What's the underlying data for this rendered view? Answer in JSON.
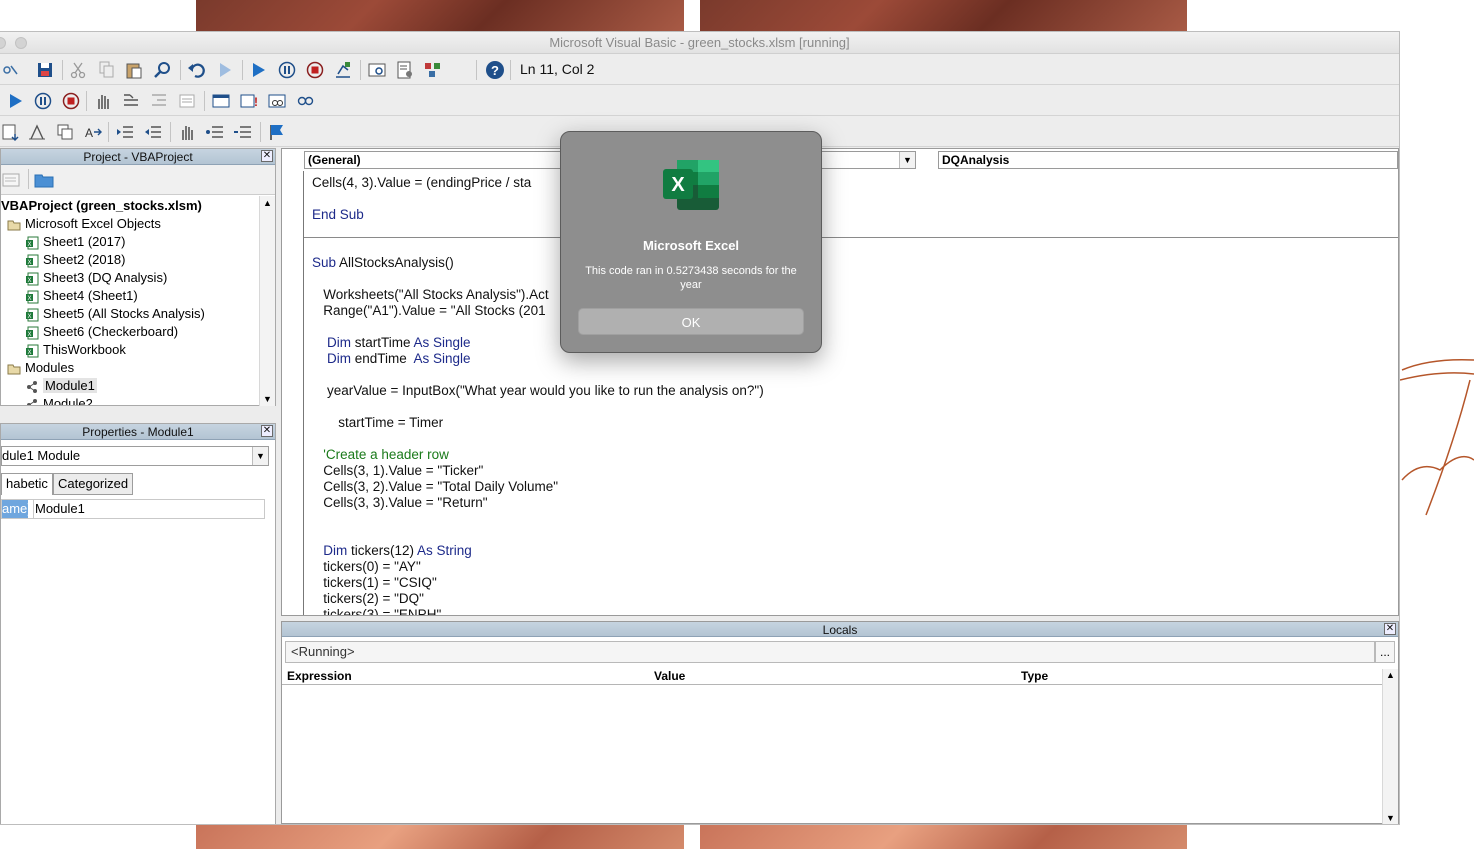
{
  "window": {
    "title": "Microsoft Visual Basic - green_stocks.xlsm [running]"
  },
  "toolbar": {
    "cursor_position": "Ln 11, Col 2"
  },
  "project_panel": {
    "title": "Project - VBAProject",
    "items": [
      {
        "label": "VBAProject (green_stocks.xlsm)",
        "level": 0,
        "type": "project"
      },
      {
        "label": "Microsoft Excel Objects",
        "level": 1,
        "type": "folder"
      },
      {
        "label": "Sheet1 (2017)",
        "level": 2,
        "type": "sheet"
      },
      {
        "label": "Sheet2 (2018)",
        "level": 2,
        "type": "sheet"
      },
      {
        "label": "Sheet3 (DQ Analysis)",
        "level": 2,
        "type": "sheet"
      },
      {
        "label": "Sheet4 (Sheet1)",
        "level": 2,
        "type": "sheet"
      },
      {
        "label": "Sheet5 (All Stocks Analysis)",
        "level": 2,
        "type": "sheet"
      },
      {
        "label": "Sheet6 (Checkerboard)",
        "level": 2,
        "type": "sheet"
      },
      {
        "label": "ThisWorkbook",
        "level": 2,
        "type": "sheet"
      },
      {
        "label": "Modules",
        "level": 1,
        "type": "folder"
      },
      {
        "label": "Module1",
        "level": 2,
        "type": "module"
      },
      {
        "label": "Module2",
        "level": 2,
        "type": "module"
      }
    ]
  },
  "properties_panel": {
    "title": "Properties - Module1",
    "object_combo": "dule1  Module",
    "tabs": [
      "habetic",
      "Categorized"
    ],
    "row_name": "ame)",
    "row_value": "Module1"
  },
  "code_window": {
    "object_combo": "(General)",
    "procedure_combo": "DQAnalysis",
    "lines": [
      {
        "segments": [
          {
            "t": "Cells(4, 3).Value = (endingPrice / sta",
            "c": "n"
          }
        ]
      },
      {
        "segments": [
          {
            "t": "",
            "c": "n"
          }
        ]
      },
      {
        "segments": [
          {
            "t": "End Sub",
            "c": "k"
          }
        ]
      },
      {
        "segments": [
          {
            "t": "",
            "c": "n"
          }
        ]
      },
      {
        "segments": [
          {
            "t": "Sub ",
            "c": "k"
          },
          {
            "t": "AllStocksAnalysis()",
            "c": "n"
          }
        ]
      },
      {
        "segments": [
          {
            "t": "",
            "c": "n"
          }
        ]
      },
      {
        "segments": [
          {
            "t": "   Worksheets(\"All Stocks Analysis\").Act",
            "c": "n"
          }
        ]
      },
      {
        "segments": [
          {
            "t": "   Range(\"A1\").Value = \"All Stocks (201",
            "c": "n"
          }
        ]
      },
      {
        "segments": [
          {
            "t": "",
            "c": "n"
          }
        ]
      },
      {
        "segments": [
          {
            "t": "    Dim ",
            "c": "k"
          },
          {
            "t": "startTime ",
            "c": "n"
          },
          {
            "t": "As Single",
            "c": "k"
          }
        ]
      },
      {
        "segments": [
          {
            "t": "    Dim ",
            "c": "k"
          },
          {
            "t": "endTime  ",
            "c": "n"
          },
          {
            "t": "As Single",
            "c": "k"
          }
        ]
      },
      {
        "segments": [
          {
            "t": "",
            "c": "n"
          }
        ]
      },
      {
        "segments": [
          {
            "t": "    yearValue = InputBox(\"What year would you like to run the analysis on?\")",
            "c": "n"
          }
        ]
      },
      {
        "segments": [
          {
            "t": "",
            "c": "n"
          }
        ]
      },
      {
        "segments": [
          {
            "t": "       startTime = Timer",
            "c": "n"
          }
        ]
      },
      {
        "segments": [
          {
            "t": "",
            "c": "n"
          }
        ]
      },
      {
        "segments": [
          {
            "t": "   'Create a header row",
            "c": "c"
          }
        ]
      },
      {
        "segments": [
          {
            "t": "   Cells(3, 1).Value = \"Ticker\"",
            "c": "n"
          }
        ]
      },
      {
        "segments": [
          {
            "t": "   Cells(3, 2).Value = \"Total Daily Volume\"",
            "c": "n"
          }
        ]
      },
      {
        "segments": [
          {
            "t": "   Cells(3, 3).Value = \"Return\"",
            "c": "n"
          }
        ]
      },
      {
        "segments": [
          {
            "t": "",
            "c": "n"
          }
        ]
      },
      {
        "segments": [
          {
            "t": "",
            "c": "n"
          }
        ]
      },
      {
        "segments": [
          {
            "t": "   Dim ",
            "c": "k"
          },
          {
            "t": "tickers(12) ",
            "c": "n"
          },
          {
            "t": "As String",
            "c": "k"
          }
        ]
      },
      {
        "segments": [
          {
            "t": "   tickers(0) = \"AY\"",
            "c": "n"
          }
        ]
      },
      {
        "segments": [
          {
            "t": "   tickers(1) = \"CSIQ\"",
            "c": "n"
          }
        ]
      },
      {
        "segments": [
          {
            "t": "   tickers(2) = \"DQ\"",
            "c": "n"
          }
        ]
      },
      {
        "segments": [
          {
            "t": "   tickers(3) = \"ENPH\"",
            "c": "n"
          }
        ]
      }
    ]
  },
  "locals": {
    "title": "Locals",
    "running_text": "<Running>",
    "ellipsis": "...",
    "columns": [
      "Expression",
      "Value",
      "Type"
    ]
  },
  "dialog": {
    "title": "Microsoft Excel",
    "message": "This code ran in 0.5273438 seconds for the year",
    "ok_label": "OK"
  },
  "colors": {
    "keyword": "#1d2a8a",
    "comment": "#1a7a1a",
    "panel_title": "#b3c4d3"
  }
}
